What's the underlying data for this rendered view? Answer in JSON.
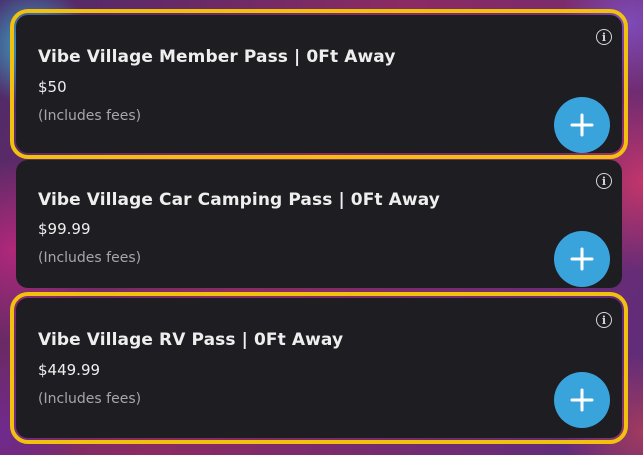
{
  "passes": [
    {
      "title": "Vibe Village Member Pass | 0Ft Away",
      "price": "$50",
      "fees": "(Includes fees)"
    },
    {
      "title": "Vibe Village Car Camping Pass | 0Ft Away",
      "price": "$99.99",
      "fees": "(Includes fees)"
    },
    {
      "title": "Vibe Village RV Pass | 0Ft Away",
      "price": "$449.99",
      "fees": "(Includes fees)"
    }
  ],
  "icons": {
    "info": "info-icon",
    "add": "plus-icon"
  },
  "colors": {
    "card_bg": "#1e1d22",
    "highlight": "#f0c20e",
    "add_button": "#39a4dc"
  },
  "info_glyph": "i"
}
